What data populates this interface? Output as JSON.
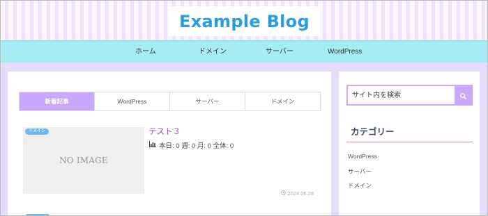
{
  "header": {
    "site_title": "Example Blog"
  },
  "nav": {
    "items": [
      {
        "label": "ホーム"
      },
      {
        "label": "ドメイン"
      },
      {
        "label": "サーバー"
      },
      {
        "label": "WordPress"
      }
    ]
  },
  "main": {
    "tabs": [
      {
        "label": "新着記事",
        "active": true
      },
      {
        "label": "WordPress",
        "active": false
      },
      {
        "label": "サーバー",
        "active": false
      },
      {
        "label": "ドメイン",
        "active": false
      }
    ],
    "posts": [
      {
        "category": "ドメイン",
        "thumbnail_text": "NO IMAGE",
        "title": "テスト３",
        "stats": "本日: 0   週: 0   月: 0   全体: 0",
        "date": "2024.06.28"
      }
    ]
  },
  "sidebar": {
    "search": {
      "placeholder": "サイト内を検索"
    },
    "category_heading": "カテゴリー",
    "categories": [
      "WordPress",
      "サーバー",
      "ドメイン"
    ]
  },
  "colors": {
    "accent": "#c8a8fb",
    "nav_bg": "#a6ecf4",
    "page_bg": "#e6dcfb",
    "title_blue": "#2a9de0",
    "post_title": "#8a45d8",
    "badge_blue": "#6fb8f0"
  },
  "icons": {
    "search": "search-icon",
    "stats": "bar-chart-icon",
    "date": "clock-icon"
  }
}
